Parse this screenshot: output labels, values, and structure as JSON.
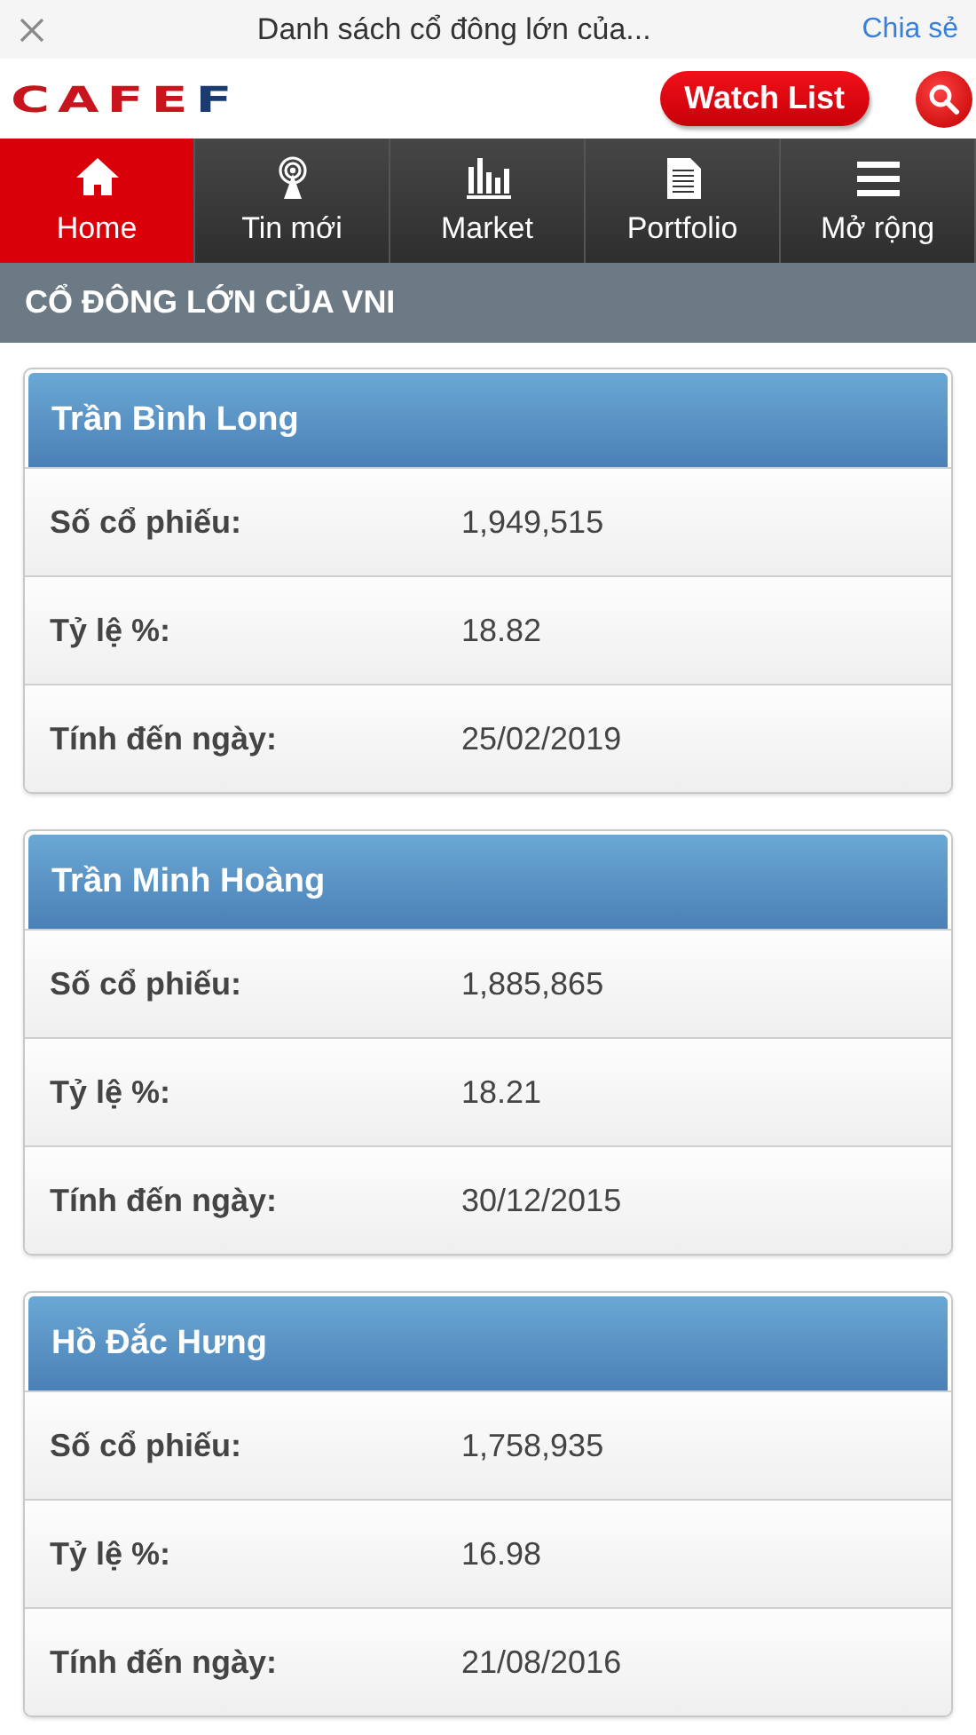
{
  "browser_bar": {
    "title": "Danh sách cổ đông lớn của...",
    "share": "Chia sẻ"
  },
  "header": {
    "logo": {
      "main": "CAFE",
      "accent": "F"
    },
    "watch_list": "Watch List"
  },
  "tabs": [
    {
      "label": "Home",
      "kind": "home",
      "selected": true
    },
    {
      "label": "Tin mới",
      "kind": "news",
      "selected": false
    },
    {
      "label": "Market",
      "kind": "market",
      "selected": false
    },
    {
      "label": "Portfolio",
      "kind": "portfolio",
      "selected": false
    },
    {
      "label": "Mở rộng",
      "kind": "more",
      "selected": false
    }
  ],
  "section_title": "CỔ ĐÔNG LỚN CỦA VNI",
  "shareholders": [
    {
      "name": "Trần Bình Long",
      "rows": [
        {
          "label": "Số cổ phiếu:",
          "value": "1,949,515"
        },
        {
          "label": "Tỷ lệ %:",
          "value": "18.82"
        },
        {
          "label": "Tính đến ngày:",
          "value": "25/02/2019"
        }
      ]
    },
    {
      "name": "Trần Minh Hoàng",
      "rows": [
        {
          "label": "Số cổ phiếu:",
          "value": "1,885,865"
        },
        {
          "label": "Tỷ lệ %:",
          "value": "18.21"
        },
        {
          "label": "Tính đến ngày:",
          "value": "30/12/2015"
        }
      ]
    },
    {
      "name": "Hồ Đắc Hưng",
      "rows": [
        {
          "label": "Số cổ phiếu:",
          "value": "1,758,935"
        },
        {
          "label": "Tỷ lệ %:",
          "value": "16.98"
        },
        {
          "label": "Tính đến ngày:",
          "value": "21/08/2016"
        }
      ]
    }
  ]
}
